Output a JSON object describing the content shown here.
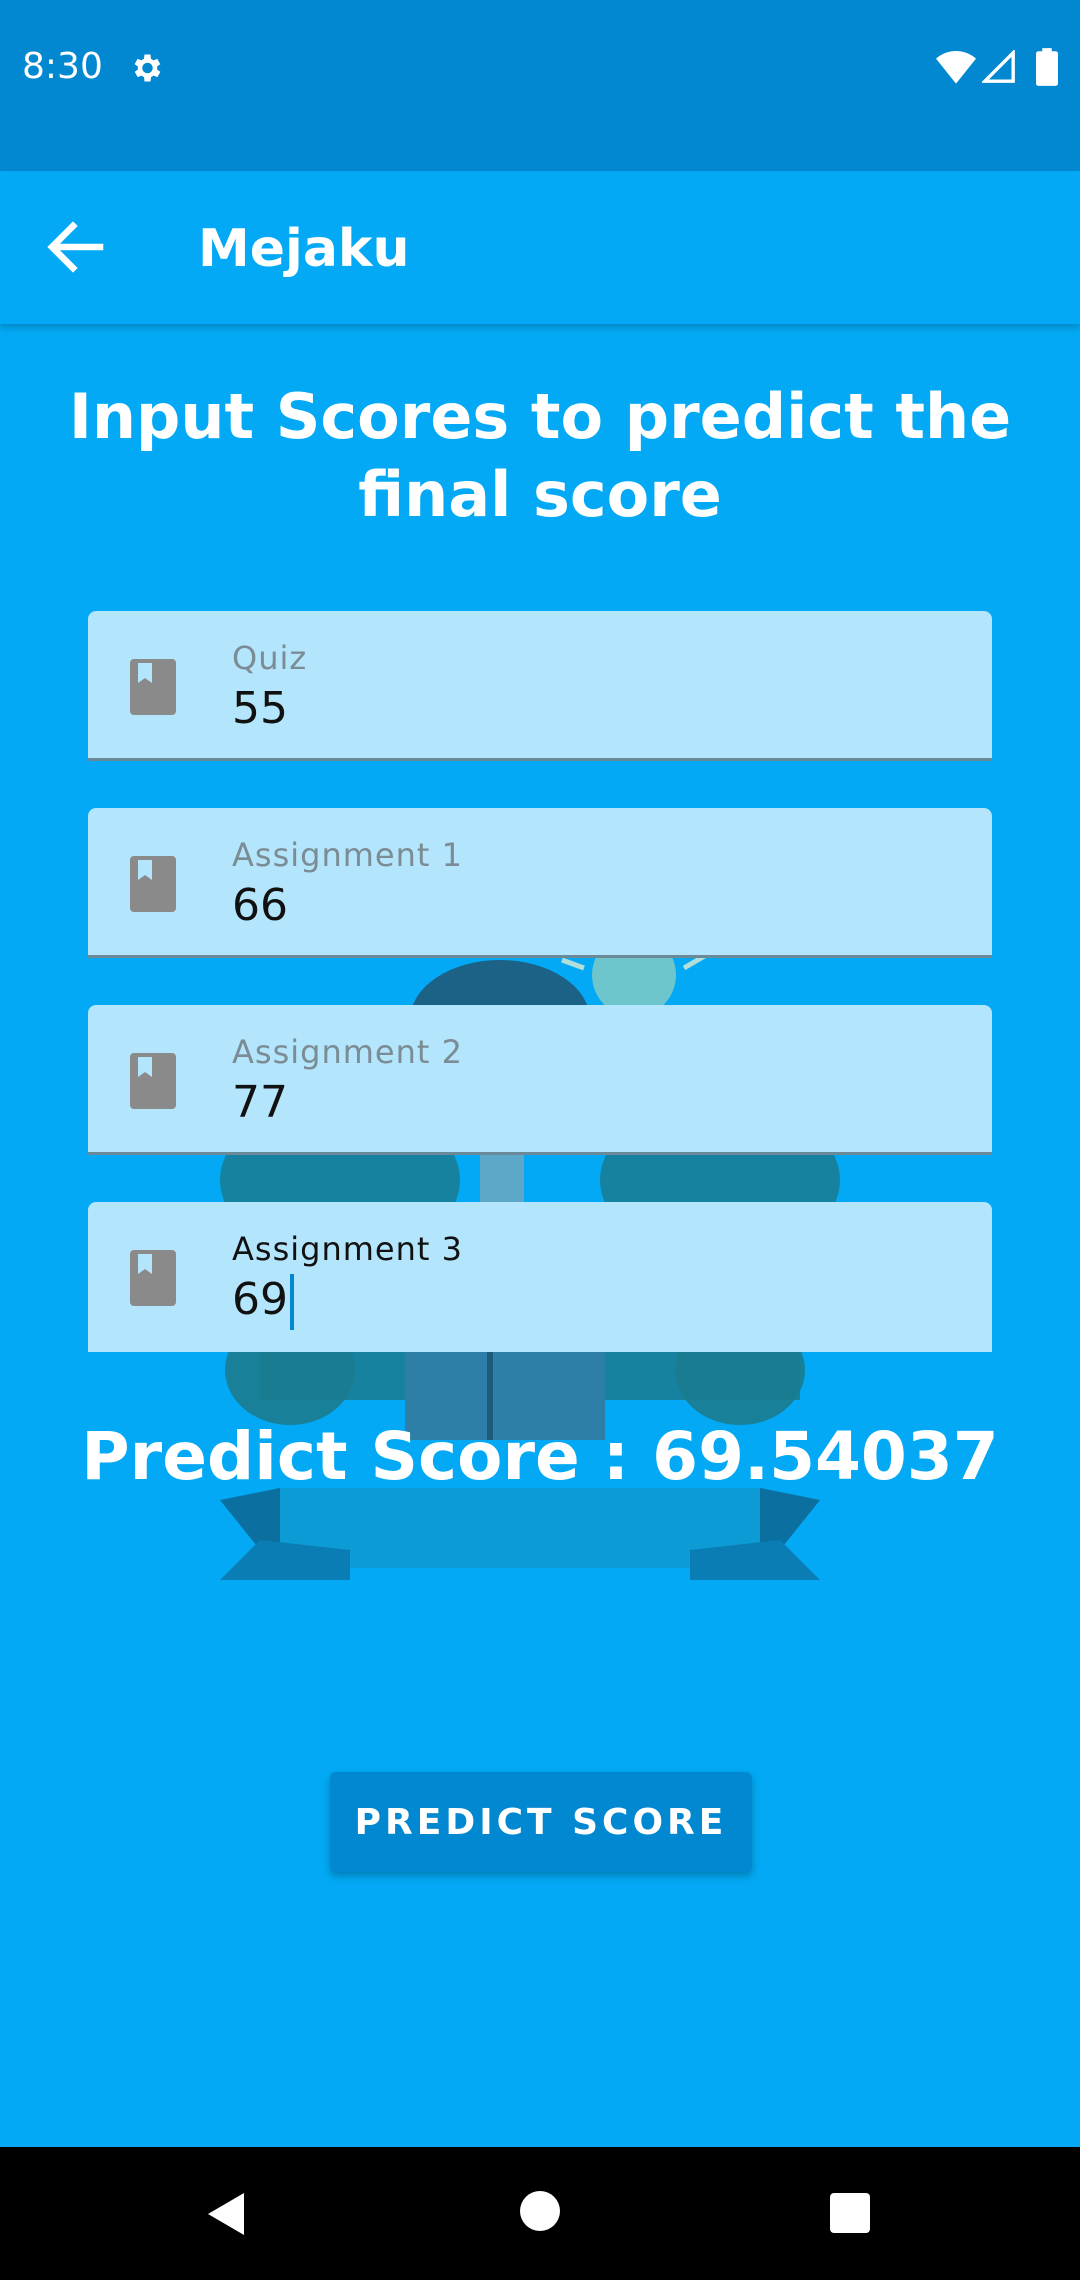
{
  "status_bar": {
    "time": "8:30"
  },
  "app_bar": {
    "title": "Mejaku"
  },
  "page": {
    "title": "Input Scores to predict the final score"
  },
  "fields": [
    {
      "label": "Quiz",
      "value": "55"
    },
    {
      "label": "Assignment 1",
      "value": "66"
    },
    {
      "label": "Assignment 2",
      "value": "77"
    },
    {
      "label": "Assignment 3",
      "value": "69"
    }
  ],
  "result": {
    "text": "Predict Score : 69.54037"
  },
  "button": {
    "label": "PREDICT SCORE"
  },
  "colors": {
    "background": "#03A9F4",
    "status_bar": "#0288D1",
    "field_background": "#B3E5FC",
    "button": "#0288D1",
    "text": "#FFFFFF"
  }
}
